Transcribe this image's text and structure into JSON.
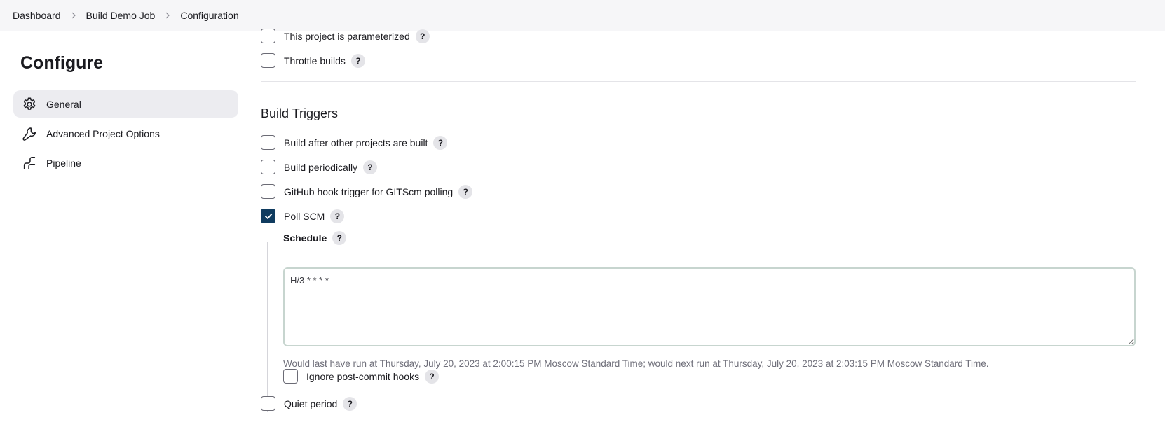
{
  "breadcrumb": {
    "items": [
      "Dashboard",
      "Build Demo Job",
      "Configuration"
    ]
  },
  "sidebar": {
    "title": "Configure",
    "items": [
      {
        "label": "General",
        "icon": "gear-icon",
        "active": true
      },
      {
        "label": "Advanced Project Options",
        "icon": "wrench-icon",
        "active": false
      },
      {
        "label": "Pipeline",
        "icon": "pipeline-icon",
        "active": false
      }
    ]
  },
  "general": {
    "options": [
      {
        "label": "This project is parameterized",
        "checked": false
      },
      {
        "label": "Throttle builds",
        "checked": false
      }
    ]
  },
  "build_triggers": {
    "title": "Build Triggers",
    "options": [
      {
        "label": "Build after other projects are built",
        "checked": false
      },
      {
        "label": "Build periodically",
        "checked": false
      },
      {
        "label": "GitHub hook trigger for GITScm polling",
        "checked": false
      },
      {
        "label": "Poll SCM",
        "checked": true
      }
    ],
    "schedule": {
      "label": "Schedule",
      "value": "H/3 * * * *",
      "note": "Would last have run at Thursday, July 20, 2023 at 2:00:15 PM Moscow Standard Time; would next run at Thursday, July 20, 2023 at 2:03:15 PM Moscow Standard Time."
    },
    "ignore_hooks": {
      "label": "Ignore post-commit hooks",
      "checked": false
    },
    "quiet_period": {
      "label": "Quiet period",
      "checked": false
    }
  },
  "help_glyph": "?",
  "colors": {
    "accent": "#0f3b5f",
    "topbar_bg": "#f6f6f8",
    "active_nav_bg": "#ececf0"
  }
}
